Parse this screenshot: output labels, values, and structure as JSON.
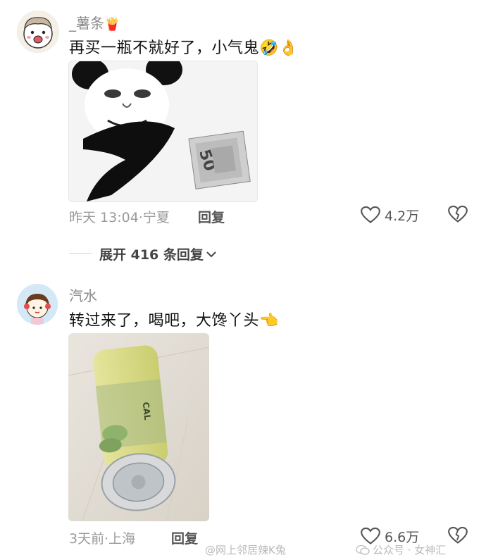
{
  "comments": [
    {
      "username": "_薯条",
      "username_emoji": "🍟",
      "text": "再买一瓶不就好了，小气鬼",
      "text_emojis": "🤣👌",
      "timestamp": "昨天 13:04",
      "location": "宁夏",
      "reply_label": "回复",
      "like_count": "4.2万",
      "image_icon": "panda-meme-with-money"
    },
    {
      "username": "汽水",
      "text": "转过来了，喝吧，大馋丫头",
      "text_emojis": "👈",
      "timestamp": "3天前",
      "location": "上海",
      "reply_label": "回复",
      "like_count": "6.6万",
      "image_icon": "lemon-drink-bottle-photo"
    }
  ],
  "expand_replies": {
    "label": "展开 416 条回复"
  },
  "watermarks": {
    "left": "@网上邻居辣K兔",
    "right": "公众号 · 女神汇"
  },
  "colors": {
    "meta_gray": "#9a9a9a",
    "text": "#111111",
    "heart_outline": "#555555"
  }
}
